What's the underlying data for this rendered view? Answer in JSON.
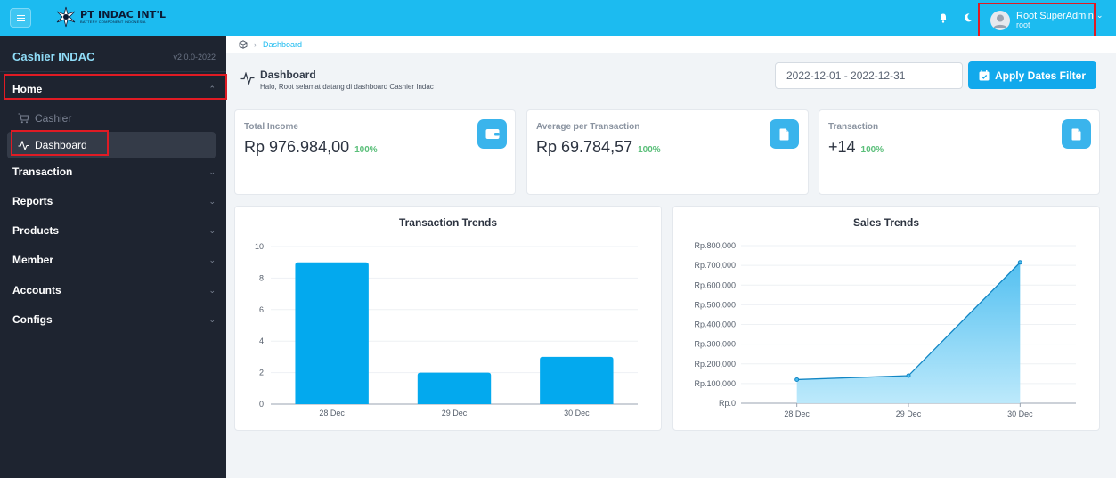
{
  "topbar": {
    "logo_title": "PT INDAC INT'L",
    "logo_subtitle": "BATTERY COMPONENT INDONESIA",
    "user_name": "Root SuperAdmin",
    "user_role": "root",
    "icons": [
      "menu-icon",
      "bell-icon",
      "moon-icon",
      "user-icon",
      "chevron-down-icon"
    ]
  },
  "sidebar": {
    "brand": "Cashier INDAC",
    "version": "v2.0.0-2022",
    "home_label": "Home",
    "home_sub": [
      {
        "label": "Cashier",
        "icon": "cart-icon"
      },
      {
        "label": "Dashboard",
        "icon": "activity-icon"
      }
    ],
    "items": [
      "Transaction",
      "Reports",
      "Products",
      "Member",
      "Accounts",
      "Configs"
    ]
  },
  "breadcrumb": {
    "current": "Dashboard"
  },
  "header": {
    "title": "Dashboard",
    "subtitle": "Halo, Root selamat datang di dashboard Cashier Indac",
    "date_range": "2022-12-01 - 2022-12-31",
    "apply_label": "Apply Dates Filter"
  },
  "stats": [
    {
      "label": "Total Income",
      "value": "Rp 976.984,00",
      "pct": "100%",
      "icon": "wallet-icon"
    },
    {
      "label": "Average per Transaction",
      "value": "Rp 69.784,57",
      "pct": "100%",
      "icon": "file-icon"
    },
    {
      "label": "Transaction",
      "value": "+14",
      "pct": "100%",
      "icon": "file-icon"
    }
  ],
  "colors": {
    "accent": "#1cbbf0",
    "bar": "#03a9ee",
    "area": "#5ccbf4",
    "sidebar": "#1e2430"
  },
  "chart_data": [
    {
      "type": "bar",
      "title": "Transaction Trends",
      "categories": [
        "28 Dec",
        "29 Dec",
        "30 Dec"
      ],
      "values": [
        9,
        2,
        3
      ],
      "ylim": [
        0,
        10
      ],
      "yticks": [
        "0",
        "2",
        "4",
        "6",
        "8",
        "10"
      ],
      "xlabel": "",
      "ylabel": "",
      "grid": true
    },
    {
      "type": "area",
      "title": "Sales Trends",
      "categories": [
        "28 Dec",
        "29 Dec",
        "30 Dec"
      ],
      "values": [
        120000,
        140000,
        715000
      ],
      "ylim": [
        0,
        800000
      ],
      "yticks": [
        "Rp.0",
        "Rp.100,000",
        "Rp.200,000",
        "Rp.300,000",
        "Rp.400,000",
        "Rp.500,000",
        "Rp.600,000",
        "Rp.700,000",
        "Rp.800,000"
      ],
      "xlabel": "",
      "ylabel": "",
      "grid": true
    }
  ]
}
